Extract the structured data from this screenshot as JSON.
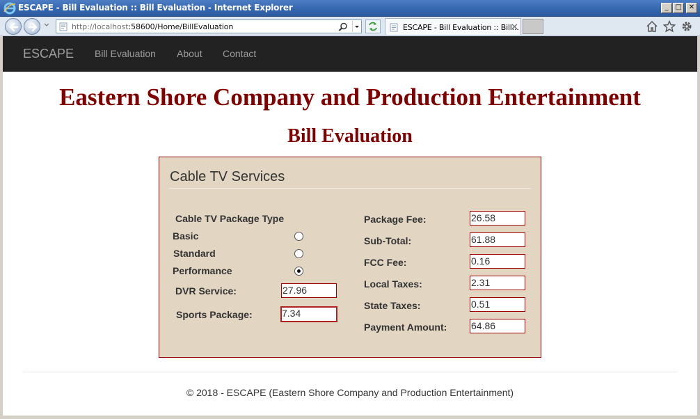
{
  "window": {
    "title": "ESCAPE - Bill Evaluation :: Bill Evaluation - Internet Explorer",
    "buttons": {
      "minimize": "_",
      "maximize": "□",
      "close": "✕"
    }
  },
  "browser": {
    "address_host": "http://localhost",
    "address_rest": ":58600/Home/BillEvaluation",
    "tab_label": "ESCAPE - Bill Evaluation :: Bill...",
    "tab_close": "✕"
  },
  "navbar": {
    "brand": "ESCAPE",
    "links": [
      "Bill Evaluation",
      "About",
      "Contact"
    ]
  },
  "page": {
    "title": "Eastern Shore Company and Production Entertainment",
    "subtitle": "Bill Evaluation"
  },
  "form": {
    "heading": "Cable TV Services",
    "package_type_label": "Cable TV Package Type",
    "packages": [
      {
        "label": "Basic",
        "checked": false
      },
      {
        "label": "Standard",
        "checked": false
      },
      {
        "label": "Performance",
        "checked": true
      }
    ],
    "dvr_label": "DVR Service:",
    "dvr_value": "27.96",
    "sports_label": "Sports Package:",
    "sports_value": "7.34",
    "results": [
      {
        "label": "Package Fee:",
        "value": "26.58"
      },
      {
        "label": "Sub-Total:",
        "value": "61.88"
      },
      {
        "label": "FCC Fee:",
        "value": "0.16"
      },
      {
        "label": "Local Taxes:",
        "value": "2.31"
      },
      {
        "label": "State Taxes:",
        "value": "0.51"
      },
      {
        "label": "Payment Amount:",
        "value": "64.86"
      }
    ]
  },
  "footer": {
    "text": "© 2018 - ESCAPE (Eastern Shore Company and Production Entertainment)"
  },
  "colors": {
    "heading": "#800000",
    "panel_bg": "#e2d5c2",
    "panel_border": "#8b0000",
    "navbar_bg": "#222222"
  }
}
